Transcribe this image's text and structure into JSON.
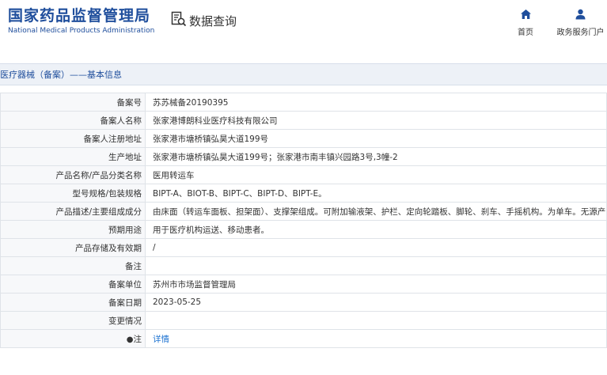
{
  "header": {
    "logo_cn": "国家药品监督管理局",
    "logo_en": "National Medical Products Administration",
    "query_icon": "document-search-icon",
    "query_label": "数据查询",
    "nav": [
      {
        "label": "首页",
        "icon": "home-icon"
      },
      {
        "label": "政务服务门户",
        "icon": "user-icon"
      }
    ]
  },
  "section": {
    "title": "医疗器械（备案）——基本信息"
  },
  "detail": {
    "rows": [
      {
        "label": "备案号",
        "value": "苏苏械备20190395"
      },
      {
        "label": "备案人名称",
        "value": "张家港博朗科业医疗科技有限公司"
      },
      {
        "label": "备案人注册地址",
        "value": "张家港市塘桥镇弘昊大道199号"
      },
      {
        "label": "生产地址",
        "value": "张家港市塘桥镇弘昊大道199号；张家港市南丰镇兴园路3号,3幢-2"
      },
      {
        "label": "产品名称/产品分类名称",
        "value": "医用转运车"
      },
      {
        "label": "型号规格/包装规格",
        "value": "BIPT-A、BIOT-B、BIPT-C、BIPT-D、BIPT-E。"
      },
      {
        "label": "产品描述/主要组成成分",
        "value": "由床面（转运车面板、担架面）、支撑架组成。可附加输液架、护栏、定向轮踏板、脚轮、刹车、手摇机构。为单车。无源产品。"
      },
      {
        "label": "预期用途",
        "value": "用于医疗机构运送、移动患者。"
      },
      {
        "label": "产品存储及有效期",
        "value": "/"
      },
      {
        "label": "备注",
        "value": ""
      },
      {
        "label": "备案单位",
        "value": "苏州市市场监督管理局"
      },
      {
        "label": "备案日期",
        "value": "2023-05-25"
      },
      {
        "label": "变更情况",
        "value": ""
      },
      {
        "label": "注",
        "value": "详情",
        "icon": "pin-icon"
      }
    ]
  },
  "colors": {
    "brand": "#1f4e9c",
    "link": "#1e73d2",
    "section_bg": "#edf1f7"
  }
}
